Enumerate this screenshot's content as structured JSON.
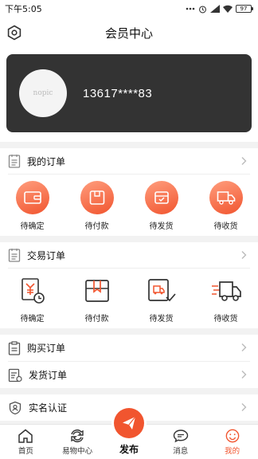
{
  "status_bar": {
    "time": "下午5:05",
    "battery": "97"
  },
  "header": {
    "title": "会员中心"
  },
  "profile": {
    "avatar_text": "nopic",
    "phone": "13617****83"
  },
  "my_orders": {
    "title": "我的订单",
    "items": [
      {
        "label": "待确定",
        "icon": "wallet-icon"
      },
      {
        "label": "待付款",
        "icon": "card-icon"
      },
      {
        "label": "待发货",
        "icon": "box-check-icon"
      },
      {
        "label": "待收货",
        "icon": "truck-icon"
      }
    ]
  },
  "trade_orders": {
    "title": "交易订单",
    "items": [
      {
        "label": "待确定",
        "icon": "yen-clock-icon"
      },
      {
        "label": "待付款",
        "icon": "package-icon"
      },
      {
        "label": "待发货",
        "icon": "truck-check-icon"
      },
      {
        "label": "待收货",
        "icon": "moving-truck-icon"
      }
    ]
  },
  "lists": {
    "purchase_orders": "购买订单",
    "shipping_orders": "发货订单",
    "verification": "实名认证"
  },
  "tab_bar": {
    "home": "首页",
    "exchange": "易物中心",
    "publish": "发布",
    "messages": "消息",
    "mine": "我的"
  },
  "colors": {
    "accent": "#f1552f",
    "card_bg": "#333333"
  }
}
